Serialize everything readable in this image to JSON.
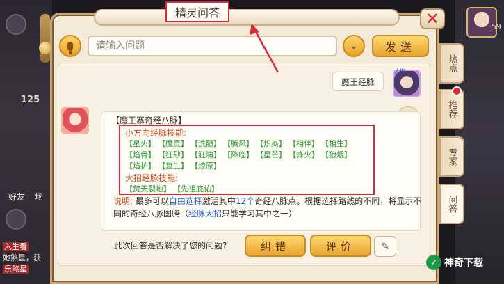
{
  "dialog": {
    "title": "精灵问答",
    "close_glyph": "✕"
  },
  "search": {
    "placeholder": "请输入问题",
    "send_label": "发送",
    "dropdown_glyph": "⌄"
  },
  "tabs": [
    {
      "label": "热点"
    },
    {
      "label": "推荐"
    },
    {
      "label": "专家"
    },
    {
      "label": "问答"
    }
  ],
  "conversation": {
    "user_question": "魔王经脉",
    "user_avatar_tag": "大神",
    "answer": {
      "title": "【魔王寨奇经八脉】",
      "small_heading": "小方向经脉技能:",
      "small_skills": [
        [
          "【星火】",
          "【魔灵】",
          "【洗髓】",
          "【腾风】",
          "【炽焱】",
          "【相伴】",
          "【相生】"
        ],
        [
          "【焰骨】",
          "【狂砂】",
          "【狂啸】",
          "【降临】",
          "【星芒】",
          "【烽火】",
          "【狼烟】"
        ],
        [
          "【焰护】",
          "【复生】",
          "【燎原】"
        ]
      ],
      "big_heading": "大招经脉技能:",
      "big_skills": [
        "【焚天裂地】",
        "【先祖庇佑】"
      ],
      "desc": {
        "label": "说明:",
        "part1": "最多可以",
        "link1": "自由选择",
        "part2": "激活其中",
        "count": "12个",
        "part3": "奇经八脉点。根据选择路线的不同，将显示不同的奇经八脉图腾（",
        "link2": "经脉大招",
        "part4": "只能学习其中之一）"
      }
    }
  },
  "feedback": {
    "question": "此次回答是否解决了您的问题?",
    "correct_label": "纠错",
    "rate_label": "评价"
  },
  "background": {
    "numbers": [
      "59",
      "125"
    ],
    "labels": [
      "好友",
      "场"
    ],
    "chat": [
      {
        "tag": "",
        "text": "入生看"
      },
      {
        "tag": "",
        "text": "她煞星，获"
      },
      {
        "tag": "",
        "text": "乐煞星"
      }
    ]
  },
  "watermark": {
    "text": "神奇下载"
  },
  "colors": {
    "accent_red": "#d8283a",
    "skill_green": "#2a9a2a",
    "heading_orange": "#d64a17",
    "link_blue": "#2a62d0",
    "button_gold": "#e8a531"
  },
  "icons": {
    "mic": "microphone-icon",
    "dropdown": "chevron-down-icon",
    "close": "close-icon",
    "edit": "edit-icon",
    "book": "book-icon"
  }
}
